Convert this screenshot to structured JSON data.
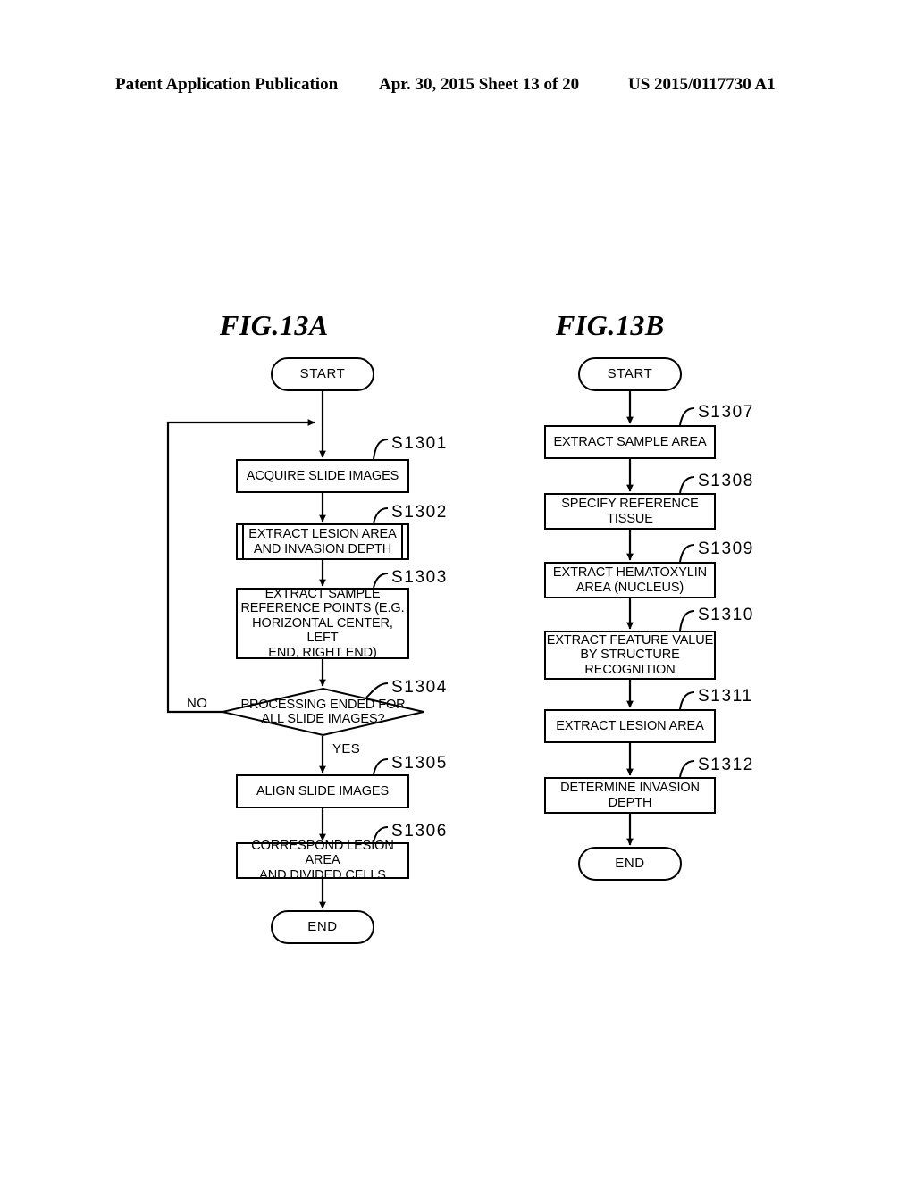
{
  "header": {
    "publication": "Patent Application Publication",
    "date_sheet": "Apr. 30, 2015  Sheet 13 of 20",
    "patent_number": "US 2015/0117730 A1"
  },
  "figures": [
    {
      "id": "fig-13a",
      "title": "FIG.13A",
      "nodes": [
        {
          "id": "a-start",
          "type": "terminator",
          "label": "START"
        },
        {
          "id": "a-s1301",
          "type": "process",
          "label": "ACQUIRE SLIDE IMAGES",
          "step": "S1301"
        },
        {
          "id": "a-s1302",
          "type": "subroutine",
          "label": "EXTRACT LESION AREA\nAND INVASION DEPTH",
          "step": "S1302"
        },
        {
          "id": "a-s1303",
          "type": "process",
          "label": "EXTRACT SAMPLE\nREFERENCE POINTS (E.G.\nHORIZONTAL CENTER, LEFT\nEND, RIGHT END)",
          "step": "S1303"
        },
        {
          "id": "a-s1304",
          "type": "decision",
          "label": "PROCESSING ENDED FOR\nALL SLIDE IMAGES?",
          "step": "S1304"
        },
        {
          "id": "a-s1305",
          "type": "process",
          "label": "ALIGN SLIDE IMAGES",
          "step": "S1305"
        },
        {
          "id": "a-s1306",
          "type": "process",
          "label": "CORRESPOND LESION AREA\nAND DIVIDED CELLS",
          "step": "S1306"
        },
        {
          "id": "a-end",
          "type": "terminator",
          "label": "END"
        }
      ],
      "branch_labels": {
        "no": "NO",
        "yes": "YES"
      }
    },
    {
      "id": "fig-13b",
      "title": "FIG.13B",
      "nodes": [
        {
          "id": "b-start",
          "type": "terminator",
          "label": "START"
        },
        {
          "id": "b-s1307",
          "type": "process",
          "label": "EXTRACT SAMPLE AREA",
          "step": "S1307"
        },
        {
          "id": "b-s1308",
          "type": "process",
          "label": "SPECIFY REFERENCE\nTISSUE",
          "step": "S1308"
        },
        {
          "id": "b-s1309",
          "type": "process",
          "label": "EXTRACT HEMATOXYLIN\nAREA (NUCLEUS)",
          "step": "S1309"
        },
        {
          "id": "b-s1310",
          "type": "process",
          "label": "EXTRACT FEATURE VALUE\nBY STRUCTURE\nRECOGNITION",
          "step": "S1310"
        },
        {
          "id": "b-s1311",
          "type": "process",
          "label": "EXTRACT LESION AREA",
          "step": "S1311"
        },
        {
          "id": "b-s1312",
          "type": "process",
          "label": "DETERMINE INVASION\nDEPTH",
          "step": "S1312"
        },
        {
          "id": "b-end",
          "type": "terminator",
          "label": "END"
        }
      ]
    }
  ],
  "colors": {
    "ink": "#000000",
    "paper": "#ffffff"
  }
}
